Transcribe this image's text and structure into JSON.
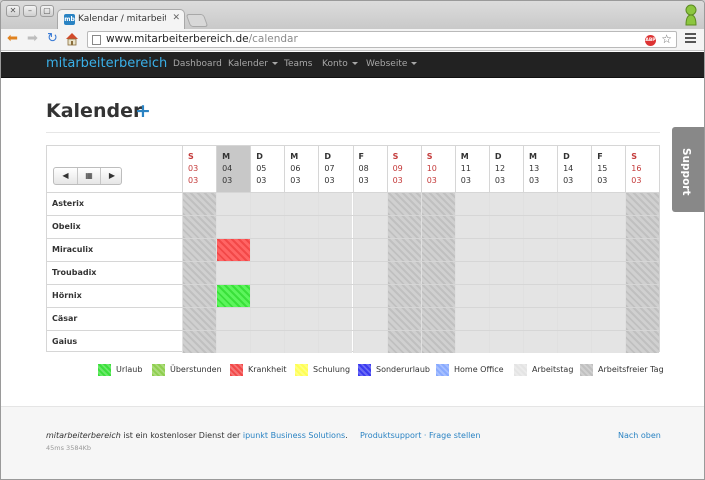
{
  "browser": {
    "tab_title": "Kalendar / mitarbeiterbe",
    "favicon_text": "mb",
    "url_host": "www.mitarbeiterbereich.de",
    "url_path": "/calendar",
    "adblock_badge": "ABP"
  },
  "navbar": {
    "brand": "mitarbeiterbereich",
    "items": [
      {
        "label": "Dashboard",
        "dropdown": false
      },
      {
        "label": "Kalender",
        "dropdown": true
      },
      {
        "label": "Teams",
        "dropdown": false
      },
      {
        "label": "Konto",
        "dropdown": true
      },
      {
        "label": "Webseite",
        "dropdown": true
      }
    ]
  },
  "page": {
    "title": "Kalender",
    "add_symbol": "+",
    "support_label": "Support"
  },
  "calendar": {
    "days": [
      {
        "dow": "S",
        "day": "03",
        "month": "03",
        "weekend": true,
        "today": false
      },
      {
        "dow": "M",
        "day": "04",
        "month": "03",
        "weekend": false,
        "today": true
      },
      {
        "dow": "D",
        "day": "05",
        "month": "03",
        "weekend": false,
        "today": false
      },
      {
        "dow": "M",
        "day": "06",
        "month": "03",
        "weekend": false,
        "today": false
      },
      {
        "dow": "D",
        "day": "07",
        "month": "03",
        "weekend": false,
        "today": false
      },
      {
        "dow": "F",
        "day": "08",
        "month": "03",
        "weekend": false,
        "today": false
      },
      {
        "dow": "S",
        "day": "09",
        "month": "03",
        "weekend": true,
        "today": false
      },
      {
        "dow": "S",
        "day": "10",
        "month": "03",
        "weekend": true,
        "today": false
      },
      {
        "dow": "M",
        "day": "11",
        "month": "03",
        "weekend": false,
        "today": false
      },
      {
        "dow": "D",
        "day": "12",
        "month": "03",
        "weekend": false,
        "today": false
      },
      {
        "dow": "M",
        "day": "13",
        "month": "03",
        "weekend": false,
        "today": false
      },
      {
        "dow": "D",
        "day": "14",
        "month": "03",
        "weekend": false,
        "today": false
      },
      {
        "dow": "F",
        "day": "15",
        "month": "03",
        "weekend": false,
        "today": false
      },
      {
        "dow": "S",
        "day": "16",
        "month": "03",
        "weekend": true,
        "today": false
      }
    ],
    "employees": [
      {
        "name": "Asterix",
        "entries": {}
      },
      {
        "name": "Obelix",
        "entries": {}
      },
      {
        "name": "Miraculix",
        "entries": {
          "1": "Krankheit"
        }
      },
      {
        "name": "Troubadix",
        "entries": {}
      },
      {
        "name": "Hörnix",
        "entries": {
          "1": "Urlaub"
        }
      },
      {
        "name": "Cäsar",
        "entries": {}
      },
      {
        "name": "Gaius",
        "entries": {}
      }
    ],
    "nav_buttons": {
      "prev": "◀",
      "today": "▦",
      "next": "▶"
    }
  },
  "legend": [
    {
      "label": "Urlaub",
      "color": "#3ae03a"
    },
    {
      "label": "Überstunden",
      "color": "#8fcf4f"
    },
    {
      "label": "Krankheit",
      "color": "#f24848"
    },
    {
      "label": "Schulung",
      "color": "#ffff55"
    },
    {
      "label": "Sonderurlaub",
      "color": "#3a3af0"
    },
    {
      "label": "Home Office",
      "color": "#88aaff"
    },
    {
      "label": "Arbeitstag",
      "color": "#e4e4e4"
    },
    {
      "label": "Arbeitsfreier Tag",
      "color": "#c0c0c0"
    }
  ],
  "footer": {
    "brand": "mitarbeiterbereich",
    "text": " ist ein kostenloser Dienst der ",
    "company": "ipunkt Business Solutions",
    "dot": ".",
    "stats": "45ms 3584Kb",
    "support_link": "Produktsupport",
    "separator": " · ",
    "question_link": "Frage stellen",
    "top_link": "Nach oben"
  }
}
